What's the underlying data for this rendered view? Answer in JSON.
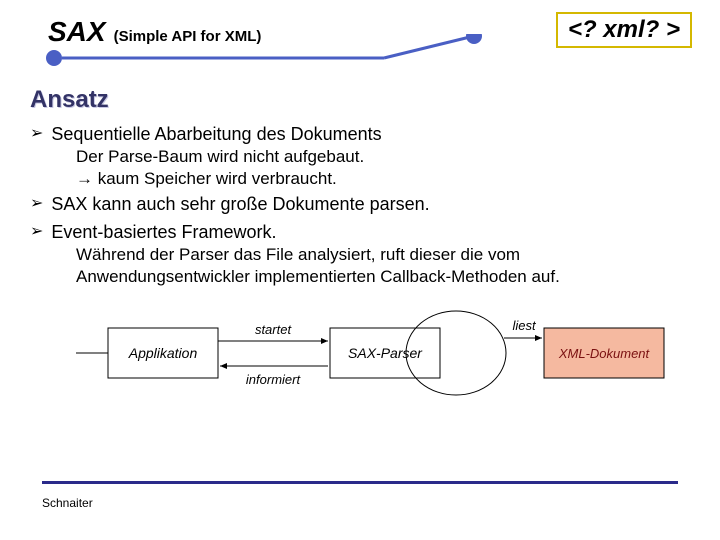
{
  "header": {
    "title_main": "SAX",
    "title_sub": "(Simple API for XML)",
    "badge": "<? xml? >"
  },
  "section": {
    "heading": "Ansatz"
  },
  "bullets": [
    {
      "text": "Sequentielle Abarbeitung des Dokuments",
      "sub": [
        "Der Parse-Baum wird nicht aufgebaut.",
        "→ kaum Speicher wird verbraucht."
      ]
    },
    {
      "text": "SAX kann auch sehr große Dokumente parsen.",
      "sub": []
    },
    {
      "text": "Event-basiertes Framework.",
      "sub": [
        "Während der Parser das File analysiert, ruft dieser die vom Anwendungsentwickler implementierten Callback-Methoden auf."
      ]
    }
  ],
  "diagram": {
    "box_app": "Applikation",
    "box_parser": "SAX-Parser",
    "box_doc": "XML-Dokument",
    "arrow_start": "startet",
    "arrow_inform": "informiert",
    "arrow_read": "liest"
  },
  "footer": {
    "author": "Schnaiter"
  }
}
